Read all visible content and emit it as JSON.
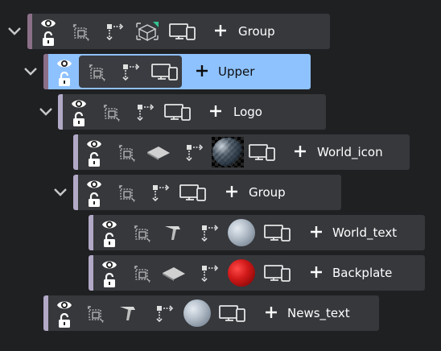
{
  "tree": {
    "rows": [
      {
        "label": "Group",
        "expanded": true
      },
      {
        "label": "Upper",
        "expanded": true,
        "selected": true
      },
      {
        "label": "Logo",
        "expanded": true
      },
      {
        "label": "World_icon"
      },
      {
        "label": "Group",
        "expanded": true
      },
      {
        "label": "World_text"
      },
      {
        "label": "Backplate"
      },
      {
        "label": "News_text"
      }
    ]
  },
  "colors": {
    "background": "#1f2022",
    "row": "#36383c",
    "selected_row": "#8ec2ff",
    "accent_bar": "#b1a9c6",
    "icon": "#d8d8d8"
  },
  "icons": {
    "visibility": "eye-icon",
    "lock": "unlock-icon",
    "bounding_box": "bounding-box-icon",
    "pivot": "pivot-axis-icon",
    "transform": "transform-cube-icon",
    "render_targets": "devices-icon",
    "add": "plus-icon",
    "expand": "chevron-down-icon"
  }
}
